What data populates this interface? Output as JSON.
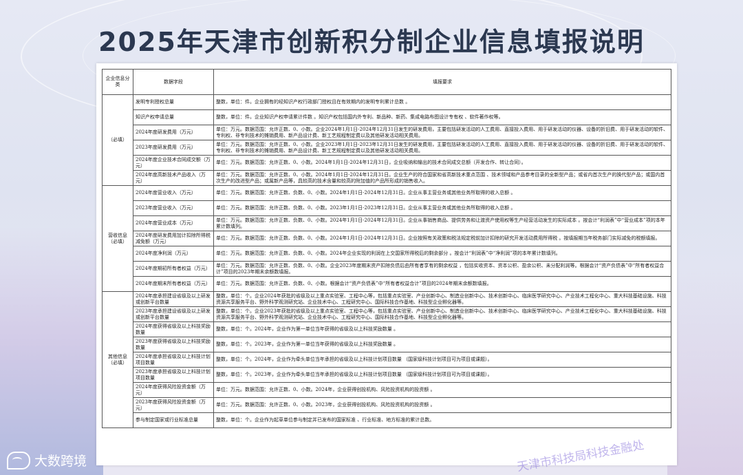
{
  "title": "2025年天津市创新积分制企业信息填报说明",
  "header": {
    "category": "企业信息分类",
    "field": "数据字段",
    "requirement": "填报要求"
  },
  "groups": [
    {
      "category": "（必填）",
      "rows": [
        {
          "field": "发明专利授权总量",
          "req": "整数，单位：件。企业拥有的经知识产权行政部门授权且在有效期内的发明专利累计总数 。"
        },
        {
          "field": "知识产权申请总量",
          "req": "整数，单位：件。企业知识产权申请累计件数 。知识产权包括国内外专利、新品种、新药、集成电路布图设计专有权 、软件著作权等。"
        },
        {
          "field": "2024年度研发费用（万元）",
          "req": "单位：万元。数据范围：允许正数、0、小数。企业2024年1月1日-2024年12月31日发生的研发费用，主要包括研发活动的人工费用、直接投入费用、用于研发活动的仪器、设备的折旧费、用于研发活动的软件、专利权、非专利技术的摊销费用、新产品设计费、新工艺规程制定费以及其他研发活动相关费用。"
        },
        {
          "field": "2023年度研发费用（万元）",
          "req": "单位：万元。数据范围：允许正数、0、小数。企业2023年1月1日-2023年12月31日发生的研发费用，主要包括研发活动的人工费用、直接投入费用、用于研发活动的仪器、设备的折旧费、用于研发活动的软件、专利权、非专利技术的摊销费用、新产品设计费、新工艺规程制定费以及其他研发活动相关费用。"
        },
        {
          "field": "2024年度企业技术合同成交额（万元）",
          "req": "单位：万元。数据范围：允许正数、0、小数。2024年1月1日-2024年12月31日，企业吸纳和输出的技术合同成交总额（开发合作、转让合同）。"
        },
        {
          "field": "2024年度高新技术产品收入（万元）",
          "req": "单位：万元。数据范围：允许正数、0、小数。2024年1月1日-2024年12月31日。企业生产的符合国家和省高新技术重点范围 、技术领域和产品参考目录的全新型产品；或省内首次生产的换代型产品；或国内首次生产的改进型产品；或属新产品等，具较高的技术含量和较高的附加值的产品所形成的销售收入。"
        }
      ]
    },
    {
      "category": "营收信息（必填）",
      "rows": [
        {
          "field": "2024年度营业收入（万元）",
          "req": "单位：万元。数据范围：允许正数、负数、0、小数。2024年1月1日-2024年12月31日。企业从事主营业务或其他业务所取得的收入总额 。"
        },
        {
          "field": "2023年度营业收入（万元）",
          "req": "单位：万元。数据范围：允许正数、负数、0、小数。2023年1月1日-2023年12月31日。企业从事主营业务或其他业务所取得的收入总额 。"
        },
        {
          "field": "2024年度营业成本（万元）",
          "req": "单位：万元。数据范围：允许正数、负数、0、小数。2024年1月1日-2024年12月31日。企业从事销售商品、提供劳务和让渡资产使用权等生产经营活动发生的实际成本 。按会计“利润表”中“营业成本”项的本年累计数填列。"
        },
        {
          "field": "2024年度研发费用加计扣除所得税减免额（万元）",
          "req": "单位：万元。数据范围：允许正数、负数、0、小数。2024年1月1日-2024年12月31日。企业按照有关政策和税法规定税前加计扣除的研究开发活动费用所得税 。按填报期当年税务部门实际减免的税额填报。"
        },
        {
          "field": "2024年度净利润（万元）",
          "req": "单位：万元。数据范围：允许正数、负数、0、小数。2024年企业实现的利润在上交国家所得税后的剩余部分 。按会计“利润表”中“净利润”项的本年累计数填列。"
        },
        {
          "field": "2024年度期初所有者权益（万元）",
          "req": "单位：万元。数据范围：允许正数、负数、0、小数。企业2023年度期末资产扣除负债后由所有者享有的剩余权益 ，包括实收资本、资本公积、盈余公积、未分配利润等。根据会计“资产负债表”中“所有者权益合计”项目的2023年期末余额数填报。"
        },
        {
          "field": "2024年度期末所有者权益（万元）",
          "req": "单位：万元。数据范围：允许正数、负数、0、小数。根据会计“资产负债表”中“所有者权益合计”项目的2024年期末余额数填报。"
        }
      ]
    },
    {
      "category": "其他信息（必填）",
      "rows": [
        {
          "field": "2024年度承担建设省级及以上研发或创新平台数量",
          "req": "整数，单位：个。企业2024年获批的省级及以上重点实验室、工程中心等，包括重点实验室、产业创新中心、制造业创新中心、技术创新中心、临床医学研究中心、产业技术工程化中心、重大科技基础设施、科技资源共享服务平台、野外科学观测研究站、企业技术中心、工程研究中心、国际科技合作基地、科技型企业孵化器等。"
        },
        {
          "field": "2023年度承担建设省级及以上研发或创新平台数量",
          "req": "整数，单位：个。企业2023年获批的省级及以上重点实验室、工程中心等，包括重点实验室、产业创新中心、制造业创新中心、技术创新中心、临床医学研究中心、产业技术工程化中心、重大科技基础设施、科技资源共享服务平台、野外科学观测研究站、企业技术中心、工程研究中心、国际科技合作基地、科技型企业孵化器等。"
        },
        {
          "field": "2024年度获得省级及以上科技奖励数量",
          "req": "整数，单位：个。2024年，企业作为第一单位当年获得的省级及以上科技奖励数量 。"
        },
        {
          "field": "2023年度获得省级及以上科技奖励数量",
          "req": "整数，单位：个。2023年，企业作为第一单位当年获得的省级及以上科技奖励数量 。"
        },
        {
          "field": "2024年度承担省级及以上科技计划项目数量",
          "req": "整数，单位：个。2024年，企业作为牵头单位当年承担的省级及以上科技计划项目数量 （国家级科技计划项目可为项目或课题）。"
        },
        {
          "field": "2023年度承担省级及以上科技计划项目数量",
          "req": "整数，单位：个。2023年，企业作为牵头单位当年承担的省级及以上科技计划项目数量 （国家级科技计划项目可为项目或课题）。"
        },
        {
          "field": "2024年度获得风险投资金额（万元）",
          "req": "单位：万元。数据范围：允许正数、0、小数。2024年，企业获得创投机构、风险投资机构的投资额 。"
        },
        {
          "field": "2023年度获得风险投资金额（万元）",
          "req": "单位：万元。数据范围：允许正数、0、小数。2023年，企业获得创投机构、风险投资机构的投资额 。"
        },
        {
          "field": "参与制定国家或行业标准总量",
          "req": "整数，单位：个。企业作为起草单位参与制定并已发布的国家标准 、行业标准、地方标准的累计总数。"
        }
      ]
    }
  ],
  "watermark": "天津市科技局科技金融处",
  "brand": "大数跨境",
  "colors": {
    "title": "#2b3850",
    "watermark": "#8c78dc"
  }
}
